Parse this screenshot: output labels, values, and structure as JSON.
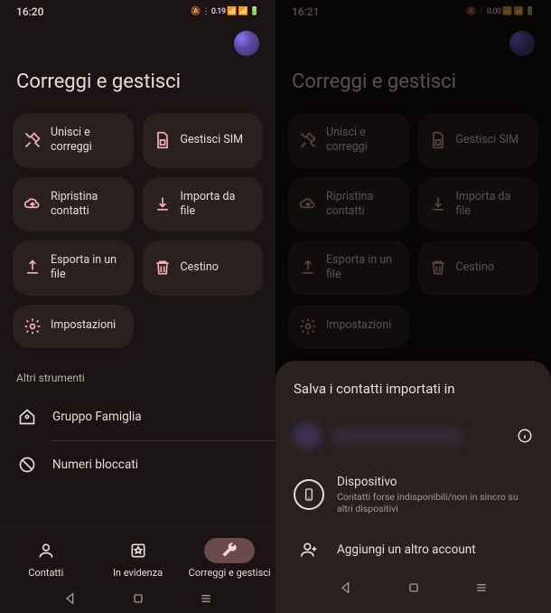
{
  "left": {
    "time": "16:20",
    "status_icons": "🔕 ⋮ 0.19 📶 📶 🔋",
    "title": "Correggi e gestisci",
    "tiles": [
      {
        "label": "Unisci e\ncorreggi"
      },
      {
        "label": "Gestisci SIM"
      },
      {
        "label": "Ripristina\ncontatti"
      },
      {
        "label": "Importa da\nfile"
      },
      {
        "label": "Esporta in un\nfile"
      },
      {
        "label": "Cestino"
      },
      {
        "label": "Impostazioni"
      }
    ],
    "section": "Altri strumenti",
    "tools": [
      {
        "label": "Gruppo Famiglia"
      },
      {
        "label": "Numeri bloccati"
      }
    ],
    "nav": [
      {
        "label": "Contatti"
      },
      {
        "label": "In evidenza"
      },
      {
        "label": "Correggi e gestisci"
      }
    ]
  },
  "right": {
    "time": "16:21",
    "status_icons": "🔕 ⋮ 0.00 📶 📶 🔋",
    "title": "Correggi e gestisci",
    "tiles": [
      {
        "label": "Unisci e\ncorreggi"
      },
      {
        "label": "Gestisci SIM"
      },
      {
        "label": "Ripristina\ncontatti"
      },
      {
        "label": "Importa da\nfile"
      },
      {
        "label": "Esporta in un\nfile"
      },
      {
        "label": "Cestino"
      },
      {
        "label": "Impostazioni"
      }
    ],
    "sheet": {
      "title": "Salva i contatti importati in",
      "device": {
        "primary": "Dispositivo",
        "secondary": "Contatti forse indisponibili/non in sincro su altri dispositivi"
      },
      "add": "Aggiungi un altro account"
    }
  }
}
